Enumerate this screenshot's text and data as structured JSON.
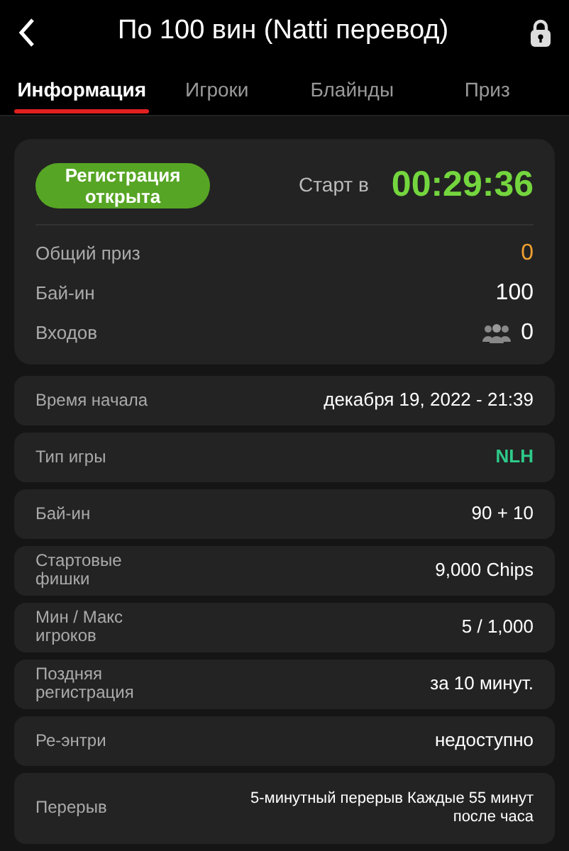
{
  "header": {
    "title": "По 100 вин (Natti перевод)",
    "locked": true
  },
  "tabs": [
    {
      "label": "Информация",
      "selected": true
    },
    {
      "label": "Игроки",
      "selected": false
    },
    {
      "label": "Блайнды",
      "selected": false
    },
    {
      "label": "Приз",
      "selected": false
    }
  ],
  "status_card": {
    "registration_badge": "Регистрация открыта",
    "start_label": "Старт в",
    "countdown": "00:29:36",
    "rows": [
      {
        "kind": "prize",
        "label": "Общий приз",
        "value": "0"
      },
      {
        "kind": "plain",
        "label": "Бай-ин",
        "value": "100"
      },
      {
        "kind": "entries",
        "label": "Входов",
        "value": "0"
      }
    ]
  },
  "details": [
    {
      "kind": "plain",
      "label": "Время начала",
      "value": "декабря 19, 2022 - 21:39"
    },
    {
      "kind": "game",
      "label": "Тип игры",
      "value": "NLH"
    },
    {
      "kind": "plain",
      "label": "Бай-ин",
      "value": "90 + 10"
    },
    {
      "kind": "plain",
      "label": "Стартовые фишки",
      "value": "9,000 Chips"
    },
    {
      "kind": "plain",
      "label": "Мин / Макс игроков",
      "value": "5 / 1,000"
    },
    {
      "kind": "plain",
      "label": "Поздняя регистрация",
      "value": "за 10 минут."
    },
    {
      "kind": "plain",
      "label": "Ре-энтри",
      "value": "недоступно"
    },
    {
      "kind": "long",
      "label": "Перерыв",
      "value": "5-минутный перерыв Каждые 55 минут после часа"
    }
  ]
}
